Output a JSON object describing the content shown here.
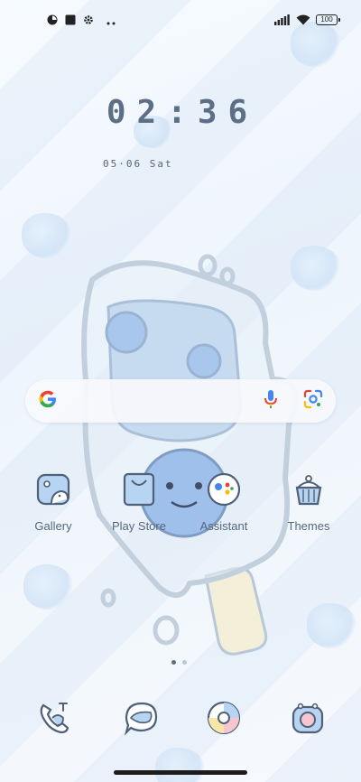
{
  "status_bar": {
    "battery": "100",
    "left_icons": [
      "data-saver-icon",
      "stop-square-icon",
      "settings-gear-icon",
      "more-dots-icon"
    ],
    "right_icons": [
      "signal-bars-icon",
      "wifi-icon",
      "battery-icon"
    ]
  },
  "clock": {
    "time": "02:36",
    "date": "05·06 Sat"
  },
  "search": {
    "icons": [
      "google-logo-icon",
      "microphone-icon",
      "google-lens-icon"
    ]
  },
  "apps": [
    {
      "label": "Gallery",
      "icon": "gallery-icon"
    },
    {
      "label": "Play Store",
      "icon": "play-store-icon"
    },
    {
      "label": "Assistant",
      "icon": "assistant-icon"
    },
    {
      "label": "Themes",
      "icon": "themes-icon"
    }
  ],
  "page_indicator": {
    "pages": 2,
    "current": 1
  },
  "dock": [
    {
      "icon": "phone-icon"
    },
    {
      "icon": "messages-icon"
    },
    {
      "icon": "browser-icon"
    },
    {
      "icon": "camera-icon"
    }
  ],
  "colors": {
    "accent": "#5c6f86",
    "icon_fill": "#b7d4f3",
    "icon_stroke": "#4f6178"
  }
}
